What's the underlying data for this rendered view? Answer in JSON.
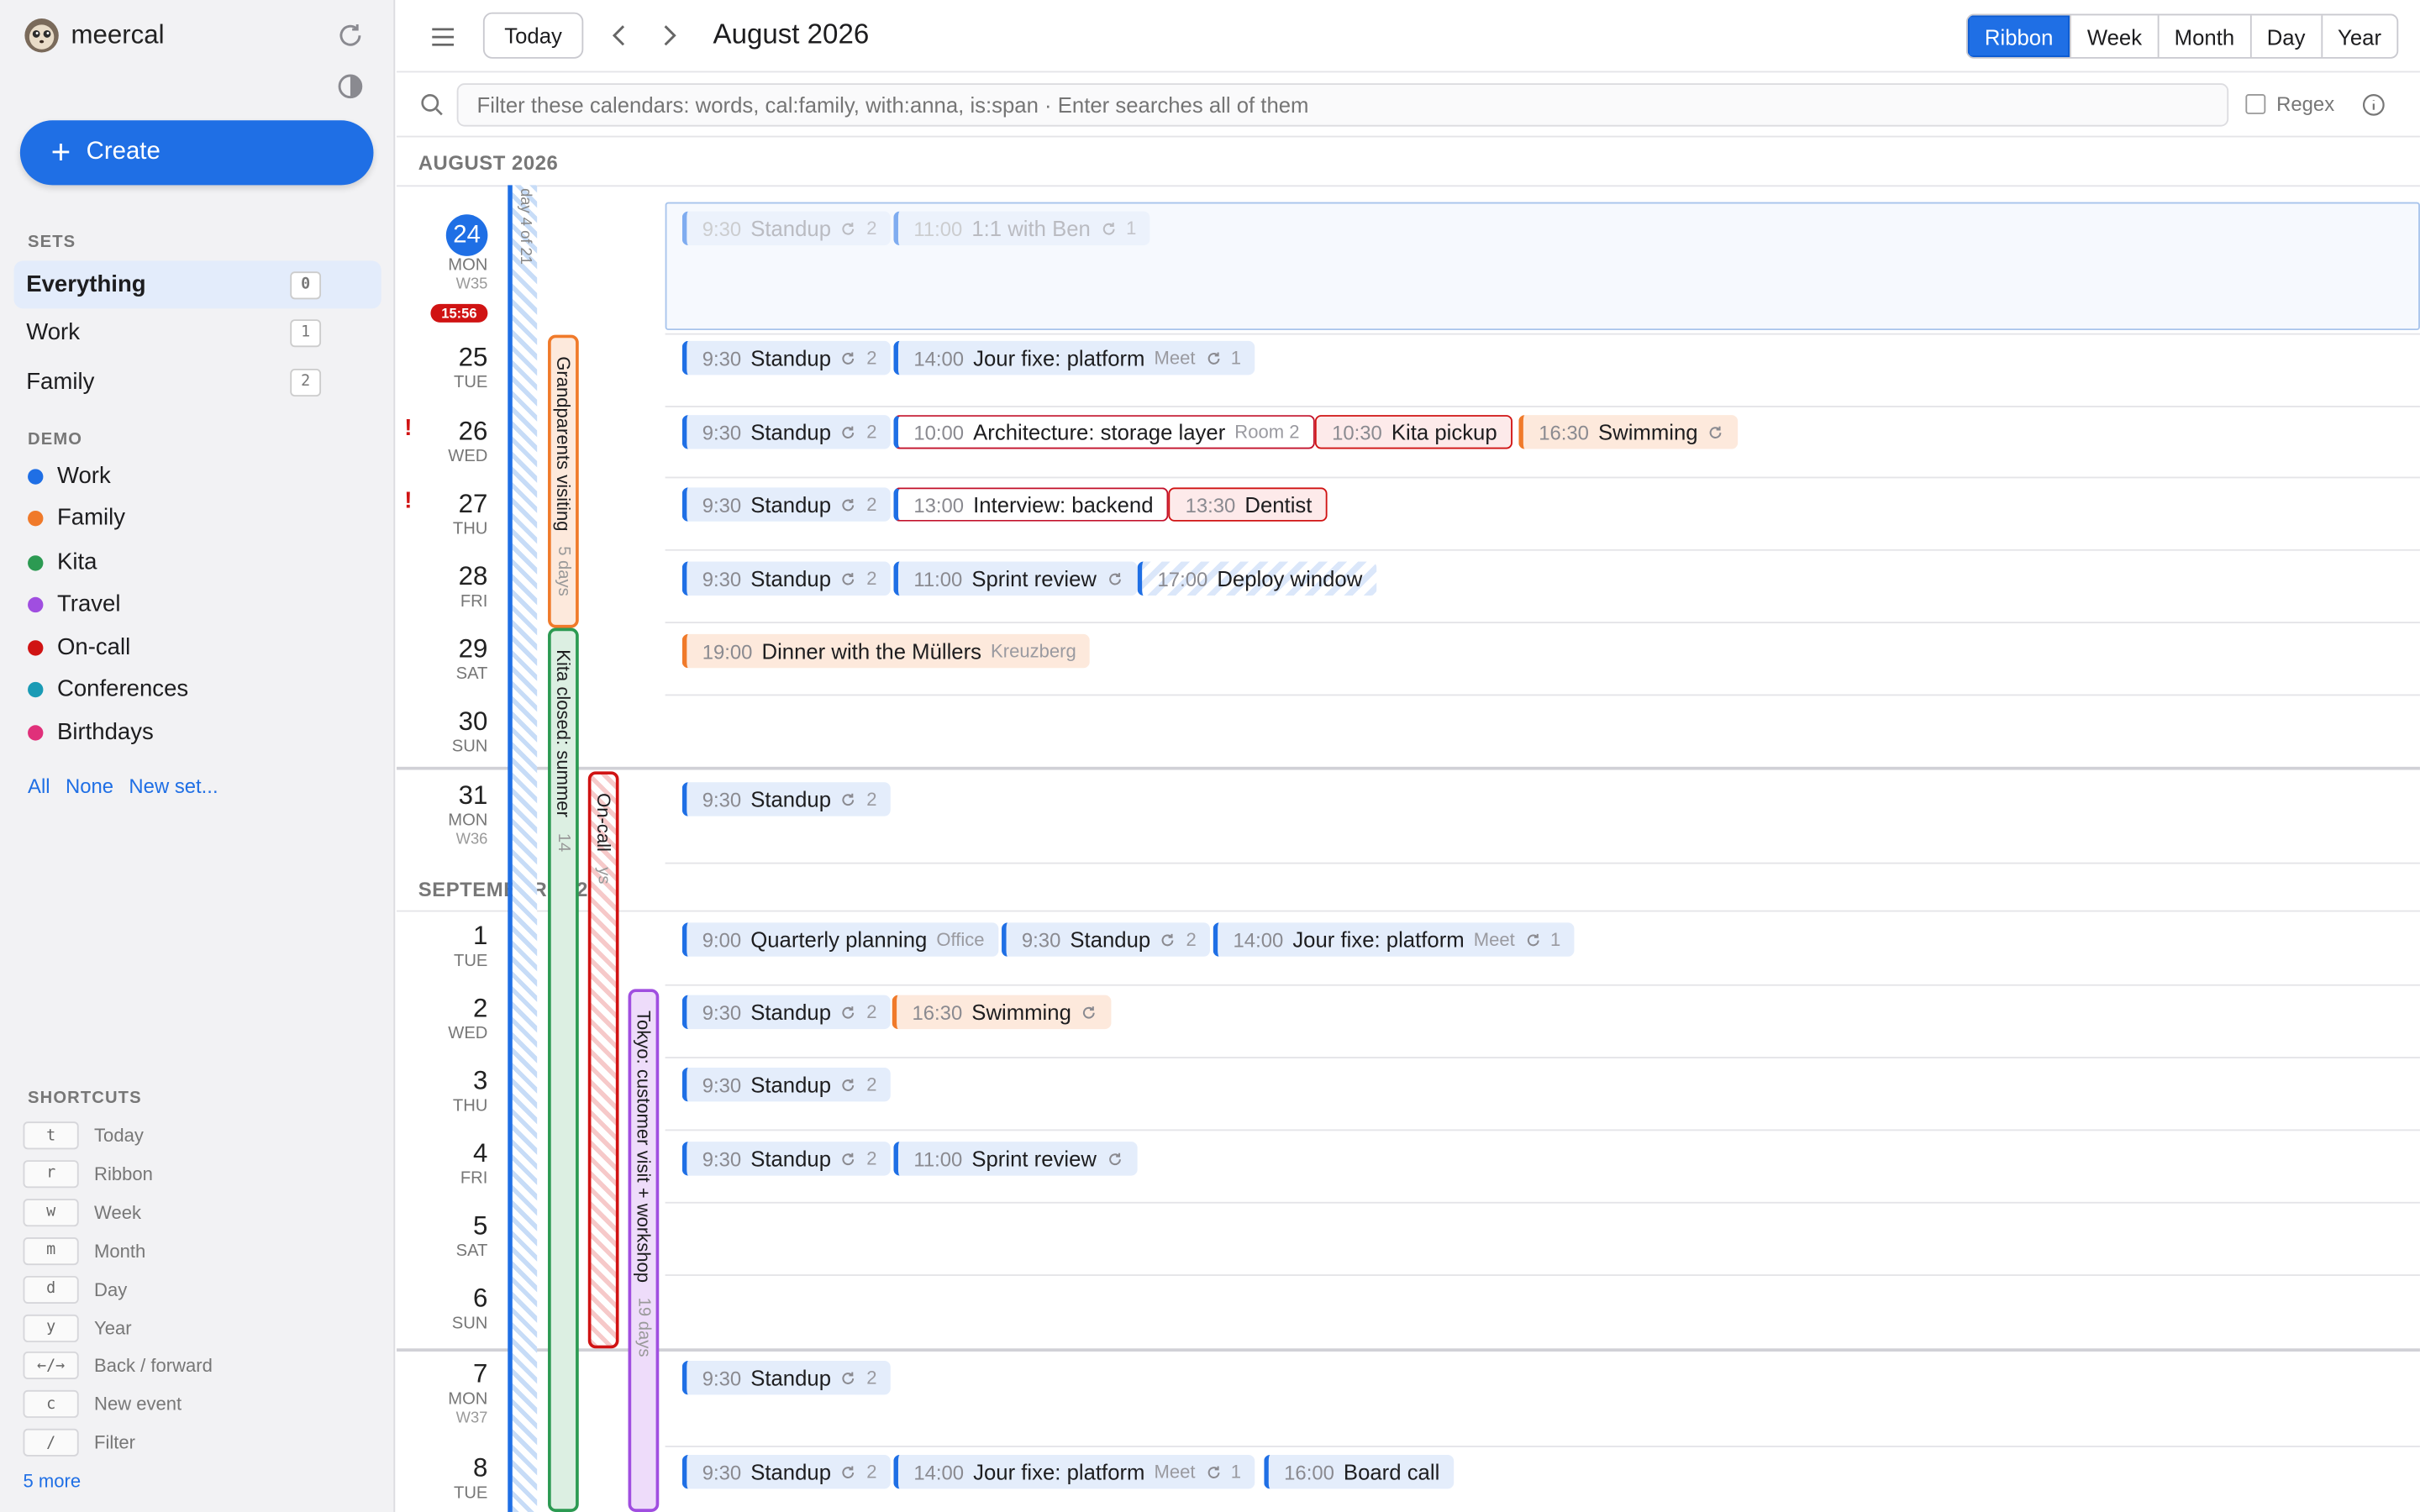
{
  "app": {
    "name": "meercal",
    "title": "August 2026"
  },
  "toolbar": {
    "today_label": "Today",
    "views": [
      "Ribbon",
      "Week",
      "Month",
      "Day",
      "Year"
    ],
    "active_view": "Ribbon"
  },
  "filter": {
    "placeholder": "Filter these calendars: words, cal:family, with:anna, is:span · Enter searches all of them",
    "regex_label": "Regex"
  },
  "sidebar": {
    "create_label": "Create",
    "sets_heading": "SETS",
    "sets": [
      {
        "label": "Everything",
        "key": "0"
      },
      {
        "label": "Work",
        "key": "1"
      },
      {
        "label": "Family",
        "key": "2"
      }
    ],
    "demo_heading": "DEMO",
    "calendars": [
      {
        "label": "Work",
        "color": "#1f6fe5"
      },
      {
        "label": "Family",
        "color": "#f07a2a"
      },
      {
        "label": "Kita",
        "color": "#2c9a52"
      },
      {
        "label": "Travel",
        "color": "#a04ee0"
      },
      {
        "label": "On-call",
        "color": "#d01313"
      },
      {
        "label": "Conferences",
        "color": "#1a9bb5"
      },
      {
        "label": "Birthdays",
        "color": "#e0307a"
      }
    ],
    "links": [
      "All",
      "None",
      "New set..."
    ],
    "shortcuts_heading": "SHORTCUTS",
    "shortcuts": [
      {
        "key": "t",
        "label": "Today"
      },
      {
        "key": "r",
        "label": "Ribbon"
      },
      {
        "key": "w",
        "label": "Week"
      },
      {
        "key": "m",
        "label": "Month"
      },
      {
        "key": "d",
        "label": "Day"
      },
      {
        "key": "y",
        "label": "Year"
      },
      {
        "key": "←/→",
        "label": "Back / forward"
      },
      {
        "key": "c",
        "label": "New event"
      },
      {
        "key": "/",
        "label": "Filter"
      }
    ],
    "more_label": "5 more"
  },
  "months": [
    "AUGUST 2026",
    "SEPTEMBER 2026"
  ],
  "now_time": "15:56",
  "days": [
    {
      "num": "24",
      "dow": "MON",
      "week": "W35"
    },
    {
      "num": "25",
      "dow": "TUE"
    },
    {
      "num": "26",
      "dow": "WED"
    },
    {
      "num": "27",
      "dow": "THU"
    },
    {
      "num": "28",
      "dow": "FRI"
    },
    {
      "num": "29",
      "dow": "SAT"
    },
    {
      "num": "30",
      "dow": "SUN"
    },
    {
      "num": "31",
      "dow": "MON",
      "week": "W36"
    },
    {
      "num": "1",
      "dow": "TUE"
    },
    {
      "num": "2",
      "dow": "WED"
    },
    {
      "num": "3",
      "dow": "THU"
    },
    {
      "num": "4",
      "dow": "FRI"
    },
    {
      "num": "5",
      "dow": "SAT"
    },
    {
      "num": "6",
      "dow": "SUN"
    },
    {
      "num": "7",
      "dow": "MON",
      "week": "W37"
    },
    {
      "num": "8",
      "dow": "TUE"
    }
  ],
  "spans": [
    {
      "label": "day 4 of 21",
      "calendar": "Work"
    },
    {
      "label": "Grandparents visiting",
      "duration": "5 days",
      "calendar": "Family"
    },
    {
      "label": "Kita closed: summer",
      "duration": "14",
      "calendar": "Kita"
    },
    {
      "label": "On-call",
      "duration": "ys",
      "calendar": "On-call"
    },
    {
      "label": "Tokyo: customer visit + workshop",
      "duration": "19 days",
      "calendar": "Travel"
    }
  ],
  "events": [
    {
      "day": "24",
      "time": "9:30",
      "title": "Standup",
      "count": "2",
      "faded": true
    },
    {
      "day": "24",
      "time": "11:00",
      "title": "1:1 with Ben",
      "count": "1",
      "faded": true
    },
    {
      "day": "25",
      "time": "9:30",
      "title": "Standup",
      "count": "2"
    },
    {
      "day": "25",
      "time": "14:00",
      "title": "Jour fixe: platform",
      "location": "Meet",
      "count": "1"
    },
    {
      "day": "26",
      "time": "9:30",
      "title": "Standup",
      "count": "2"
    },
    {
      "day": "26",
      "time": "10:00",
      "title": "Architecture: storage layer",
      "location": "Room 2"
    },
    {
      "day": "26",
      "time": "10:30",
      "title": "Kita pickup"
    },
    {
      "day": "26",
      "time": "16:30",
      "title": "Swimming"
    },
    {
      "day": "27",
      "time": "9:30",
      "title": "Standup",
      "count": "2"
    },
    {
      "day": "27",
      "time": "13:00",
      "title": "Interview: backend"
    },
    {
      "day": "27",
      "time": "13:30",
      "title": "Dentist"
    },
    {
      "day": "28",
      "time": "9:30",
      "title": "Standup",
      "count": "2"
    },
    {
      "day": "28",
      "time": "11:00",
      "title": "Sprint review"
    },
    {
      "day": "28",
      "time": "17:00",
      "title": "Deploy window"
    },
    {
      "day": "29",
      "time": "19:00",
      "title": "Dinner with the Müllers",
      "location": "Kreuzberg"
    },
    {
      "day": "31",
      "time": "9:30",
      "title": "Standup",
      "count": "2"
    },
    {
      "day": "1",
      "time": "9:00",
      "title": "Quarterly planning",
      "location": "Office"
    },
    {
      "day": "1",
      "time": "9:30",
      "title": "Standup",
      "count": "2"
    },
    {
      "day": "1",
      "time": "14:00",
      "title": "Jour fixe: platform",
      "location": "Meet",
      "count": "1"
    },
    {
      "day": "2",
      "time": "9:30",
      "title": "Standup",
      "count": "2"
    },
    {
      "day": "2",
      "time": "16:30",
      "title": "Swimming"
    },
    {
      "day": "3",
      "time": "9:30",
      "title": "Standup",
      "count": "2"
    },
    {
      "day": "4",
      "time": "9:30",
      "title": "Standup",
      "count": "2"
    },
    {
      "day": "4",
      "time": "11:00",
      "title": "Sprint review"
    },
    {
      "day": "7",
      "time": "9:30",
      "title": "Standup",
      "count": "2"
    },
    {
      "day": "8",
      "time": "9:30",
      "title": "Standup",
      "count": "2"
    },
    {
      "day": "8",
      "time": "14:00",
      "title": "Jour fixe: platform",
      "location": "Meet",
      "count": "1"
    },
    {
      "day": "8",
      "time": "16:00",
      "title": "Board call"
    }
  ],
  "icons": [
    "refresh-icon",
    "contrast-icon",
    "menu-icon",
    "chevron-left-icon",
    "chevron-right-icon",
    "search-icon",
    "info-icon",
    "repeat-icon",
    "alert-icon"
  ]
}
